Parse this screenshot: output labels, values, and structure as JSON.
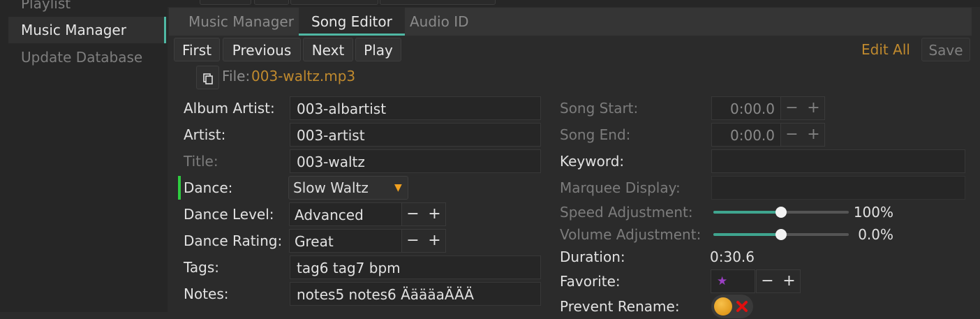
{
  "sidebar": {
    "items": [
      {
        "label": "Playlist Management"
      },
      {
        "label": "Music Manager"
      },
      {
        "label": "Update Database"
      }
    ]
  },
  "tabs": [
    {
      "label": "Music Manager"
    },
    {
      "label": "Song Editor"
    },
    {
      "label": "Audio ID"
    }
  ],
  "toolbar": {
    "first": "First",
    "previous": "Previous",
    "next": "Next",
    "play": "Play",
    "edit_all": "Edit All",
    "save": "Save"
  },
  "file": {
    "label": "File:",
    "name": "003-waltz.mp3"
  },
  "left_fields": {
    "album_artist": {
      "label": "Album Artist:",
      "value": "003-albartist"
    },
    "artist": {
      "label": "Artist:",
      "value": "003-artist"
    },
    "title": {
      "label": "Title:",
      "value": "003-waltz"
    },
    "dance": {
      "label": "Dance:",
      "value": "Slow Waltz"
    },
    "dance_level": {
      "label": "Dance Level:",
      "value": "Advanced"
    },
    "dance_rating": {
      "label": "Dance Rating:",
      "value": "Great"
    },
    "tags": {
      "label": "Tags:",
      "value": "tag6 tag7 bpm"
    },
    "notes": {
      "label": "Notes:",
      "value": "notes5 notes6  ÄäääaÄÄÄ"
    }
  },
  "right_fields": {
    "song_start": {
      "label": "Song Start:",
      "value": "0:00.0"
    },
    "song_end": {
      "label": "Song End:",
      "value": "0:00.0"
    },
    "keyword": {
      "label": "Keyword:",
      "value": ""
    },
    "marquee": {
      "label": "Marquee Display:",
      "value": ""
    },
    "speed": {
      "label": "Speed Adjustment:",
      "value": "100%",
      "fraction": 0.5
    },
    "volume": {
      "label": "Volume Adjustment:",
      "value": "0.0%",
      "fraction": 0.5
    },
    "duration": {
      "label": "Duration:",
      "value": "0:30.6"
    },
    "favorite": {
      "label": "Favorite:",
      "value": "★"
    },
    "prevent_rename": {
      "label": "Prevent Rename:"
    }
  },
  "stepper": {
    "minus": "−",
    "plus": "+"
  },
  "dropdown_arrow": "▼",
  "colors": {
    "accent": "#4fb8a4",
    "file_name": "#c08a2e",
    "edit_all": "#c08a2e",
    "favorite_star": "#9b3fc4",
    "dance_marker": "#2ecc40",
    "dropdown_arrow": "#f0a020"
  }
}
